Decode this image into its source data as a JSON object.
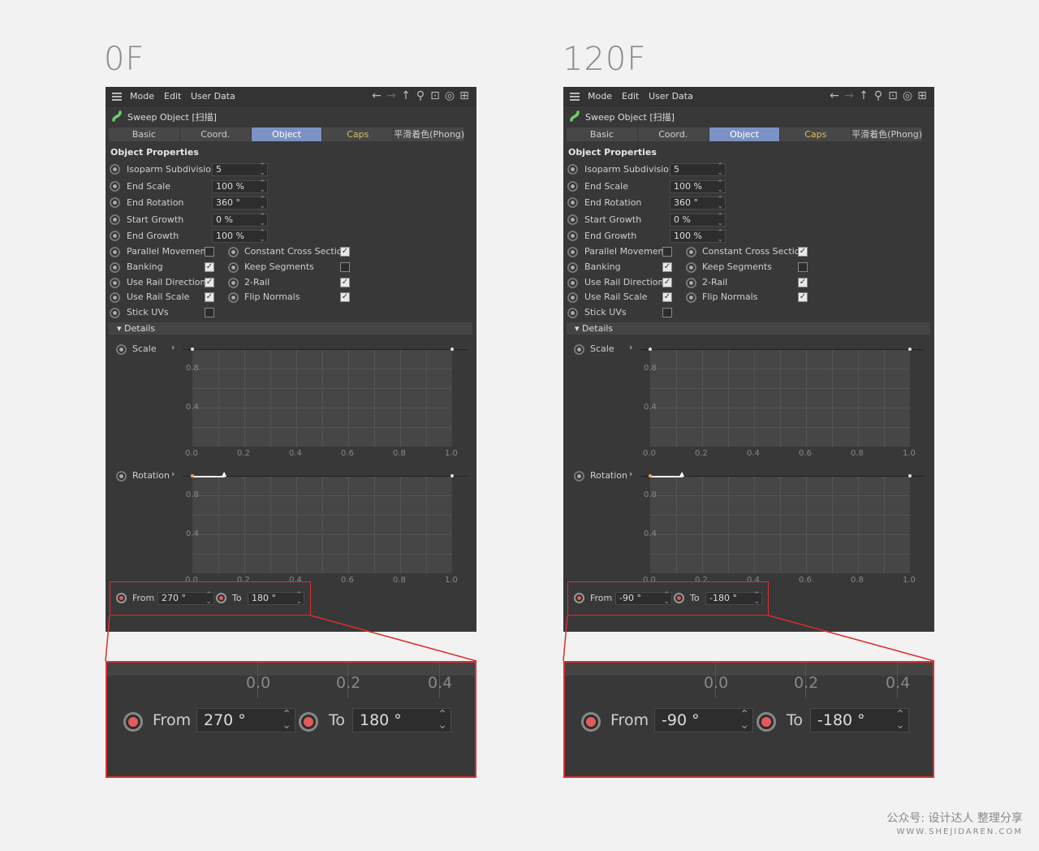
{
  "frames": [
    {
      "label": "0F",
      "menu": [
        "Mode",
        "Edit",
        "User Data"
      ],
      "object_title": "Sweep Object [扫描]",
      "tabs": [
        "Basic",
        "Coord.",
        "Object",
        "Caps",
        "平滑着色(Phong)"
      ],
      "active_tab": "Object",
      "section": "Object Properties",
      "fields": [
        {
          "label": "Isoparm Subdivision",
          "value": "5"
        },
        {
          "label": "End Scale",
          "value": "100 %"
        },
        {
          "label": "End Rotation",
          "value": "360 °"
        },
        {
          "label": "Start Growth",
          "value": "0 %"
        },
        {
          "label": "End Growth",
          "value": "100 %"
        }
      ],
      "checks_left": [
        {
          "label": "Parallel Movement",
          "checked": false
        },
        {
          "label": "Banking",
          "checked": true
        },
        {
          "label": "Use Rail Direction",
          "checked": true
        },
        {
          "label": "Use Rail Scale",
          "checked": true
        },
        {
          "label": "Stick UVs",
          "checked": false
        }
      ],
      "checks_right": [
        {
          "label": "Constant Cross Section",
          "checked": true
        },
        {
          "label": "Keep Segments",
          "checked": false
        },
        {
          "label": "2-Rail",
          "checked": true
        },
        {
          "label": "Flip Normals",
          "checked": true
        }
      ],
      "details": "Details",
      "scale_label": "Scale",
      "rotation_label": "Rotation",
      "y_ticks": [
        "0.8",
        "0.4"
      ],
      "x_ticks": [
        "0.0",
        "0.2",
        "0.4",
        "0.6",
        "0.8",
        "1.0"
      ],
      "from_label": "From",
      "from_value": "270 °",
      "to_label": "To",
      "to_value": "180 °"
    },
    {
      "label": "120F",
      "menu": [
        "Mode",
        "Edit",
        "User Data"
      ],
      "object_title": "Sweep Object [扫描]",
      "tabs": [
        "Basic",
        "Coord.",
        "Object",
        "Caps",
        "平滑着色(Phong)"
      ],
      "active_tab": "Object",
      "section": "Object Properties",
      "fields": [
        {
          "label": "Isoparm Subdivision",
          "value": "5"
        },
        {
          "label": "End Scale",
          "value": "100 %"
        },
        {
          "label": "End Rotation",
          "value": "360 °"
        },
        {
          "label": "Start Growth",
          "value": "0 %"
        },
        {
          "label": "End Growth",
          "value": "100 %"
        }
      ],
      "checks_left": [
        {
          "label": "Parallel Movement",
          "checked": false
        },
        {
          "label": "Banking",
          "checked": true
        },
        {
          "label": "Use Rail Direction",
          "checked": true
        },
        {
          "label": "Use Rail Scale",
          "checked": true
        },
        {
          "label": "Stick UVs",
          "checked": false
        }
      ],
      "checks_right": [
        {
          "label": "Constant Cross Section",
          "checked": true
        },
        {
          "label": "Keep Segments",
          "checked": false
        },
        {
          "label": "2-Rail",
          "checked": true
        },
        {
          "label": "Flip Normals",
          "checked": true
        }
      ],
      "details": "Details",
      "scale_label": "Scale",
      "rotation_label": "Rotation",
      "y_ticks": [
        "0.8",
        "0.4"
      ],
      "x_ticks": [
        "0.0",
        "0.2",
        "0.4",
        "0.6",
        "0.8",
        "1.0"
      ],
      "from_label": "From",
      "from_value": "-90 °",
      "to_label": "To",
      "to_value": "-180 °"
    }
  ],
  "zoom_ticks": [
    "0.0",
    "0.2",
    "0.4"
  ],
  "watermark": {
    "line1": "公众号: 设计达人 整理分享",
    "line2": "WWW.SHEJIDAREN.COM"
  },
  "colors": {
    "accent": "#7c92c4",
    "caps": "#d9c05a",
    "highlight": "#d93030",
    "panel": "#383838"
  }
}
